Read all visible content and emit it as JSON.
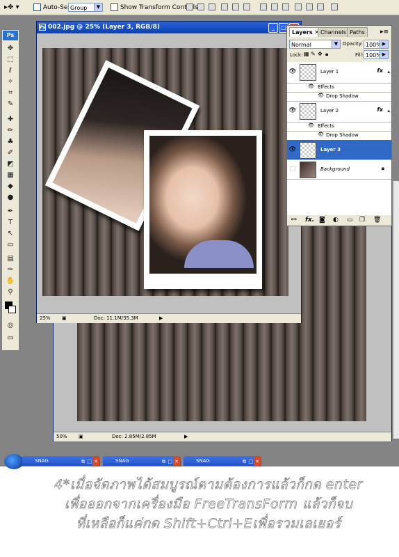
{
  "options_bar": {
    "auto_select_label": "Auto-Select:",
    "auto_select_value": "Group",
    "show_transform_label": "Show Transform Controls"
  },
  "doc_front": {
    "title": "002.jpg @ 25% (Layer 3, RGB/8)",
    "zoom": "25%",
    "doc_size": "Doc: 11.1M/35.3M"
  },
  "doc_back": {
    "zoom": "50%",
    "doc_size": "Doc: 2.85M/2.85M"
  },
  "layers_panel": {
    "tabs": [
      "Layers",
      "Channels",
      "Paths"
    ],
    "blend_mode": "Normal",
    "opacity_label": "Opacity:",
    "opacity_value": "100%",
    "lock_label": "Lock:",
    "fill_label": "Fill:",
    "fill_value": "100%",
    "layers": [
      {
        "name": "Layer 1",
        "effects": "Effects",
        "shadow": "Drop Shadow",
        "fx": "fx"
      },
      {
        "name": "Layer 2",
        "effects": "Effects",
        "shadow": "Drop Shadow",
        "fx": "fx"
      },
      {
        "name": "Layer 3"
      },
      {
        "name": "Background"
      }
    ]
  },
  "taskbar": [
    "SNAG",
    "SNAG",
    "SNAG"
  ],
  "caption": {
    "line1": "4*เมื่อจัดภาพได้สมบูรณ์ตามต้องการแล้วก็กด enter",
    "line2": "เพื่อออกจากเครื่องมือ FreeTransForm แล้วก็จบ",
    "line3": "ที่เหลือก็แค่กด Shift+Ctrl+Eเพื่อรวมเลเยอร์"
  },
  "colors": {
    "selected_layer": "#3169c6",
    "titlebar": "#0842b4",
    "panel_bg": "#ece9d8"
  }
}
